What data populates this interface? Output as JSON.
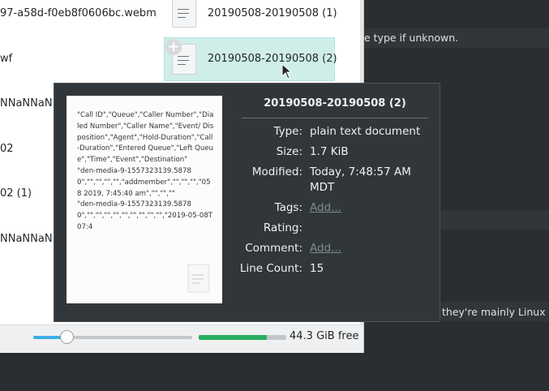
{
  "background": {
    "text_top": "e type if unknown.",
    "text_bottom": "they're mainly Linux"
  },
  "file_list": {
    "left_column": [
      "97-a58d-f0eb8f0606bc.webm",
      "wf",
      "NNaNNaN",
      "02",
      "02 (1)",
      "NNaNNaN"
    ],
    "right_column": [
      {
        "label": "20190508-20190508 (1)",
        "icon": "text-document-icon",
        "selected": false
      },
      {
        "label": "20190508-20190508 (2)",
        "icon": "text-document-icon",
        "selected": true
      }
    ],
    "add_badge": "+"
  },
  "statusbar": {
    "zoom_fraction": 0.21,
    "space_used_fraction": 0.78,
    "free_space_label": "44.3 GiB free"
  },
  "tooltip": {
    "title": "20190508-20190508 (2)",
    "preview_text": "\"Call ID\",\"Queue\",\"Caller Number\",\"Dialed Number\",\"Caller Name\",\"Event/ Disposition\",\"Agent\",\"Hold-Duration\",\"Call-Duration\",\"Entered Queue\",\"Left Queue\",\"Time\",\"Event\",\"Destination\"\n\"den-media-9-1557323139.58780\",\"\",\"\",\"\",\"\",\"addmember\",\"\",\"\",\"\",\"05 8 2019, 7:45:40 am\",\"\",\"\",\"\"\n\"den-media-9-1557323139.58780\",\"\",\"\",\"\",\"\",\"\",\"\",\"\",\"\",\"\",\"2019-05-08T07:4",
    "fields": [
      {
        "key": "Type:",
        "value": "plain text document",
        "link": false
      },
      {
        "key": "Size:",
        "value": "1.7 KiB",
        "link": false
      },
      {
        "key": "Modified:",
        "value": "Today, 7:48:57 AM",
        "value2": "MDT",
        "link": false
      },
      {
        "key": "Tags:",
        "value": "Add...",
        "link": true
      },
      {
        "key": "Rating:",
        "value": "",
        "link": false
      },
      {
        "key": "Comment:",
        "value": "Add...",
        "link": true
      },
      {
        "key": "Line Count:",
        "value": "15",
        "link": false
      }
    ]
  },
  "colors": {
    "accent": "#3daee9",
    "selection": "#cfeee9",
    "free_space_bar": "#27ae60",
    "tooltip_bg": "#31363b",
    "link": "#7f8c8d"
  }
}
